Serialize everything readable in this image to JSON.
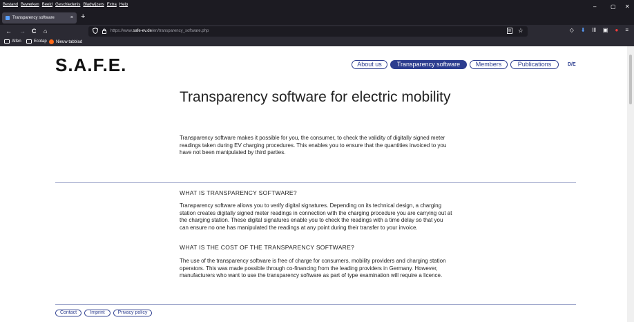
{
  "menubar": {
    "items": [
      "Bestand",
      "Bewerken",
      "Beeld",
      "Geschiedenis",
      "Bladwijzers",
      "Extra",
      "Help"
    ]
  },
  "window_controls": {
    "minimize": "–",
    "maximize": "▢",
    "close": "✕"
  },
  "tab": {
    "title": "Transparency software",
    "close": "×",
    "new_tab": "+"
  },
  "nav": {
    "back": "←",
    "forward": "→",
    "reload": "C",
    "home": "⌂"
  },
  "url": {
    "prefix": "https://www.",
    "domain": "safe-ev.de",
    "path": "/en/transparency_software.php",
    "reader_icon": "reader-icon",
    "bookmark_star": "☆"
  },
  "toolbar_icons": [
    "pocket-icon",
    "download-icon",
    "library-icon",
    "sidebar-icon",
    "extension-icon",
    "menu-icon"
  ],
  "toolbar_glyphs": [
    "◇",
    "⬇",
    "lll",
    "▣",
    "●",
    "≡"
  ],
  "bookmarks": [
    {
      "label": "Alfen",
      "icon": "folder-icon"
    },
    {
      "label": "Ecotap",
      "icon": "folder-icon"
    },
    {
      "label": "Nieuw tabblad",
      "icon": "firefox-icon"
    }
  ],
  "site": {
    "logo": "S.A.F.E.",
    "nav": [
      "About us",
      "Transparency software",
      "Members",
      "Publications"
    ],
    "lang": "D/E",
    "title": "Transparency software for electric mobility",
    "intro": "Transparency software makes it possible for you, the consumer, to check the validity of digitally signed meter readings taken during EV charging procedures. This enables you to ensure that the quantities invoiced to you have not been manipulated by third parties.",
    "section1_title": "WHAT IS TRANSPARENCY SOFTWARE?",
    "section1_text": "Transparency software allows you to verify digital signatures. Depending on its technical design, a charging station creates digitally signed meter readings in connection with the charging procedure you are carrying out at the charging station. These digital signatures enable you to check the readings with a time delay so that you can ensure no one has manipulated the readings at any point during their transfer to your invoice.",
    "section2_title": "WHAT IS THE COST OF THE TRANSPARENCY SOFTWARE?",
    "section2_text": "The use of the transparency software is free of charge for consumers, mobility providers and charging station operators. This was made possible through co-financing from the leading providers in Germany. However, manufacturers who want to use the transparency software as part of type examination will require a licence.",
    "footer": [
      "Contact",
      "Imprint",
      "Privacy policy"
    ]
  },
  "colors": {
    "accent": "#2c3d8f",
    "chrome_dark": "#1c1b22",
    "chrome_mid": "#2b2a33"
  }
}
